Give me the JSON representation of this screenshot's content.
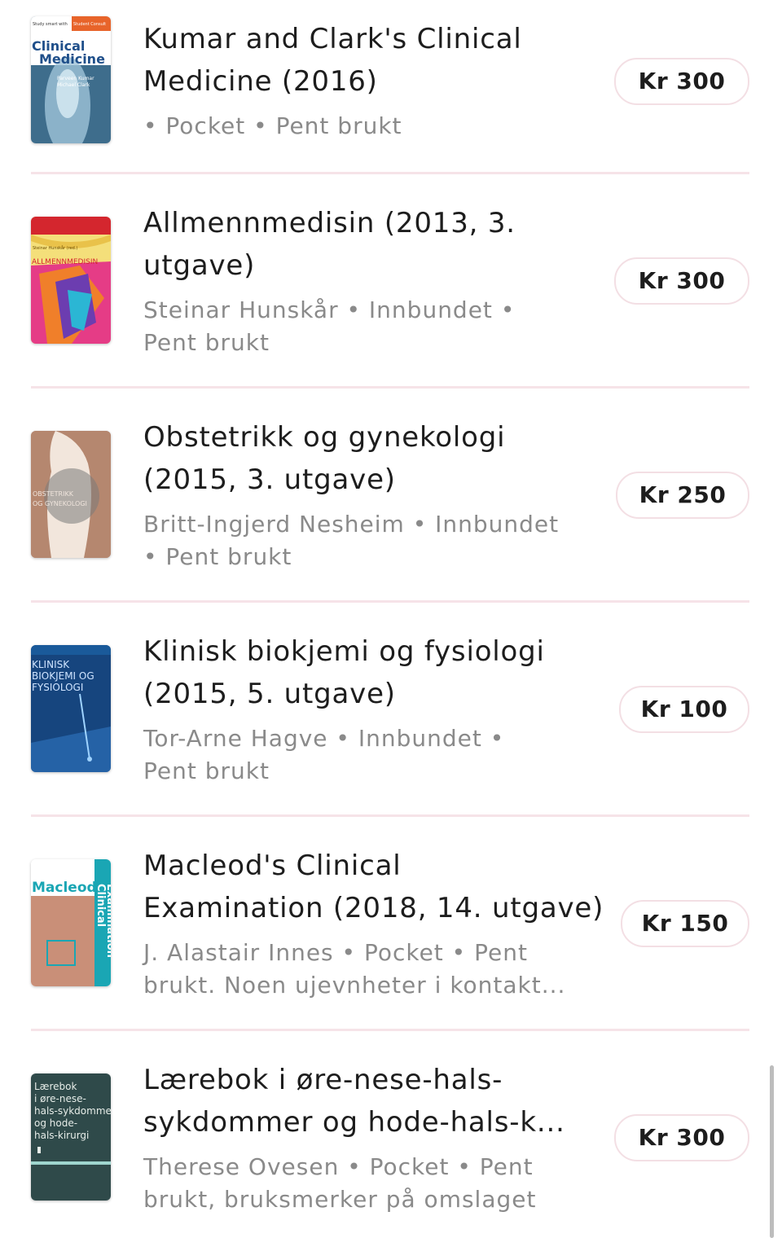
{
  "listings": [
    {
      "title_line1": "Kumar and Clark's Clinical",
      "title_line2": "Medicine (2016)",
      "meta_line1": " • Pocket • Pent brukt",
      "meta_line2": "",
      "price": "Kr 300",
      "cover": {
        "texts": [
          "Study smart with",
          "Student Consult",
          "Clinical",
          "Medicine",
          "Parveen Kumar",
          "Michael Clark"
        ]
      }
    },
    {
      "title_line1": "Allmennmedisin (2013, 3.",
      "title_line2": "utgave)",
      "meta_line1": "Steinar Hunskår • Innbundet •",
      "meta_line2": "Pent brukt",
      "price": "Kr 300",
      "cover": {
        "texts": [
          "Steinar Hunskår (red.)",
          "ALLMENNMEDISIN"
        ]
      }
    },
    {
      "title_line1": "Obstetrikk og gynekologi",
      "title_line2": "(2015, 3. utgave)",
      "meta_line1": "Britt-Ingjerd Nesheim • Innbundet",
      "meta_line2": "• Pent brukt",
      "price": "Kr 250",
      "cover": {
        "texts": [
          "OBSTETRIKK",
          "OG GYNEKOLOGI"
        ]
      }
    },
    {
      "title_line1": "Klinisk biokjemi og fysiologi",
      "title_line2": "(2015, 5. utgave)",
      "meta_line1": "Tor-Arne Hagve • Innbundet •",
      "meta_line2": "Pent brukt",
      "price": "Kr 100",
      "cover": {
        "texts": [
          "KLINISK",
          "BIOKJEMI OG",
          "FYSIOLOGI"
        ]
      }
    },
    {
      "title_line1": "Macleod's Clinical",
      "title_line2": "Examination (2018, 14. utgave)",
      "meta_line1": "J. Alastair Innes • Pocket • Pent",
      "meta_line2": "brukt. Noen ujevnheter i kontakt...",
      "price": "Kr 150",
      "cover": {
        "texts": [
          "Macleod's",
          "Clinical",
          "Examination"
        ]
      }
    },
    {
      "title_line1": "Lærebok i øre-nese-hals-",
      "title_line2": "sykdommer og hode-hals-k...",
      "meta_line1": "Therese Ovesen • Pocket • Pent",
      "meta_line2": "brukt, bruksmerker på omslaget",
      "price": "Kr 300",
      "cover": {
        "texts": [
          "Lærebok",
          "i øre-nese-",
          "hals-sykdommer",
          "og hode-",
          "hals-kirurgi"
        ]
      }
    }
  ]
}
